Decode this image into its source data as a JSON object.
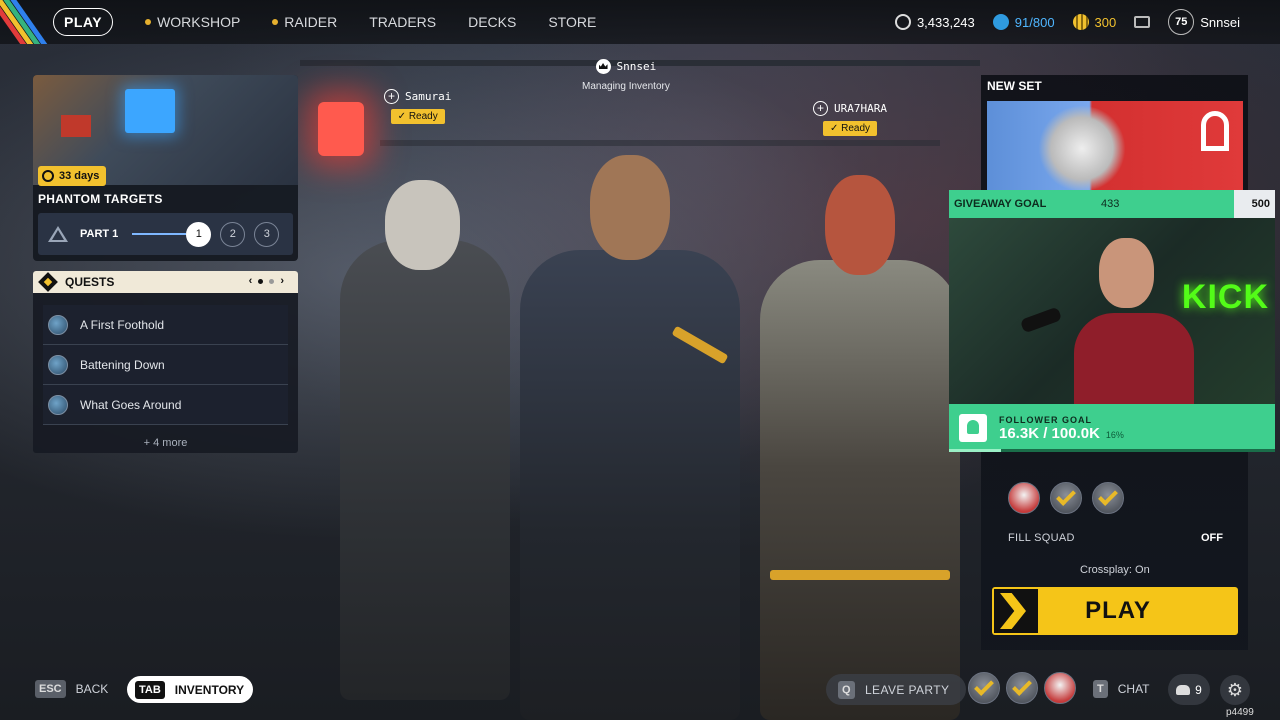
{
  "nav": {
    "play_label": "PLAY",
    "items": [
      {
        "label": "WORKSHOP",
        "dot": true
      },
      {
        "label": "RAIDER",
        "dot": true
      },
      {
        "label": "TRADERS",
        "dot": false
      },
      {
        "label": "DECKS",
        "dot": false
      },
      {
        "label": "STORE",
        "dot": false
      }
    ],
    "stripe_colors": [
      "#e23b3b",
      "#f2c12e",
      "#36b37e",
      "#2f80ed"
    ]
  },
  "currencies": {
    "coins": "3,433,243",
    "tokens": "91/800",
    "credits": "300",
    "level": "75",
    "username": "Snnsei",
    "icons": [
      "coin-icon",
      "token-icon",
      "credits-icon",
      "mail-icon"
    ]
  },
  "phantom_targets": {
    "days_left": "33 days",
    "title": "PHANTOM TARGETS",
    "part_label": "PART 1",
    "steps": [
      "1",
      "2",
      "3"
    ],
    "active_step": 1
  },
  "quests": {
    "header": "QUESTS",
    "prev": "‹",
    "next": "›",
    "items": [
      "A First Foothold",
      "Battening Down",
      "What Goes Around"
    ],
    "more": "+ 4 more"
  },
  "squad": {
    "left": {
      "name": "Samurai",
      "status": "Ready"
    },
    "center": {
      "name": "Snnsei",
      "status": "Managing Inventory"
    },
    "right": {
      "name": "URA7HARA",
      "status": "Ready"
    }
  },
  "right_panel": {
    "new_set_label": "NEW SET",
    "fill_squad_label": "FILL SQUAD",
    "fill_squad_value": "OFF",
    "crossplay": "Crossplay: On",
    "play_label": "PLAY"
  },
  "stream_overlay": {
    "giveaway_label": "GIVEAWAY GOAL",
    "giveaway_current": "433",
    "giveaway_target": "500",
    "kick_text": "KICK",
    "follower_label": "FOLLOWER GOAL",
    "follower_value": "16.3K / 100.0K",
    "follower_percent": "16%",
    "follower_progress": 0.16
  },
  "bottom_bar": {
    "esc_key": "ESC",
    "back_label": "BACK",
    "tab_key": "TAB",
    "inventory_label": "INVENTORY",
    "leave_key": "Q",
    "leave_label": "LEAVE PARTY",
    "chat_key": "T",
    "chat_label": "CHAT",
    "friends_count": "9",
    "settings_icon": "⚙",
    "player_id": "p4499"
  },
  "colors": {
    "accent_yellow": "#f5c518",
    "stream_green": "#3ecf8e"
  }
}
